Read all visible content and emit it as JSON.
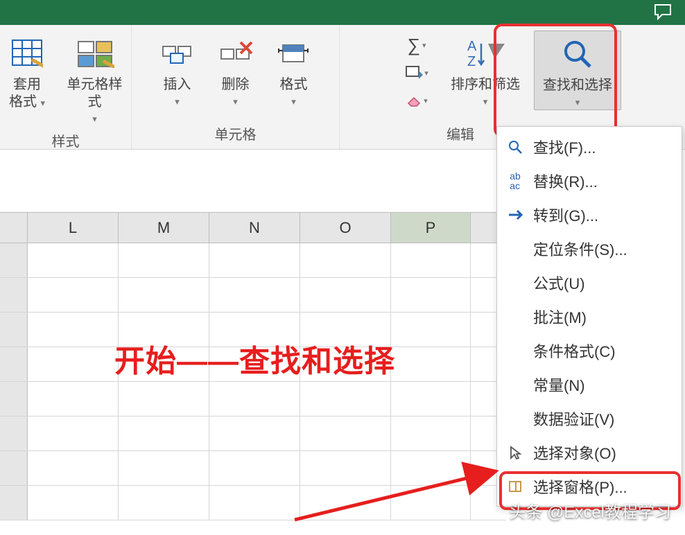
{
  "titlebar": {
    "chat_icon": "💬"
  },
  "ribbon": {
    "styles_group": {
      "apply_format_lines": [
        "套用",
        "格式"
      ],
      "cell_styles": "单元格样式",
      "label": "样式"
    },
    "cells_group": {
      "insert": "插入",
      "delete": "删除",
      "format": "格式",
      "label": "单元格"
    },
    "editing_group": {
      "sort_filter": "排序和筛选",
      "find_select": "查找和选择",
      "label": "编辑"
    }
  },
  "menu": {
    "find": "查找(F)...",
    "replace": "替换(R)...",
    "goto": "转到(G)...",
    "goto_special": "定位条件(S)...",
    "formulas": "公式(U)",
    "comments": "批注(M)",
    "cond_fmt": "条件格式(C)",
    "constants": "常量(N)",
    "data_val": "数据验证(V)",
    "sel_obj": "选择对象(O)",
    "sel_pane": "选择窗格(P)..."
  },
  "columns": [
    "L",
    "M",
    "N",
    "O",
    "P"
  ],
  "annotation": "开始——查找和选择",
  "watermark": "头条 @Excel教程学习"
}
